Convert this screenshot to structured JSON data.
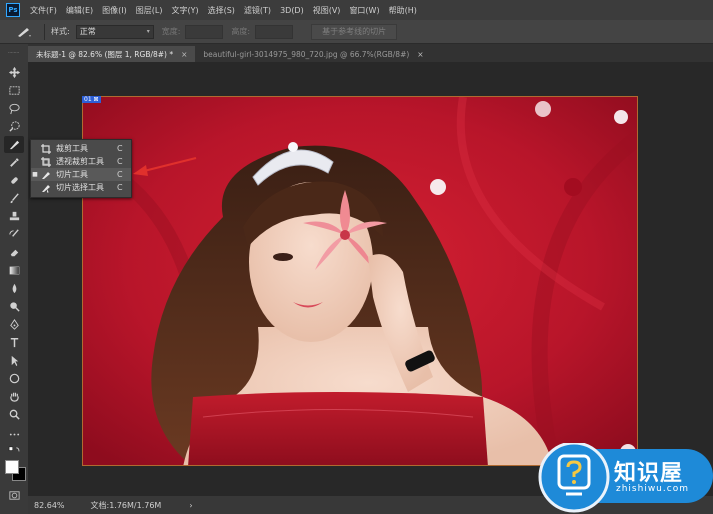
{
  "app": {
    "logo_text": "Ps"
  },
  "menu": [
    "文件(F)",
    "编辑(E)",
    "图像(I)",
    "图层(L)",
    "文字(Y)",
    "选择(S)",
    "滤镜(T)",
    "3D(D)",
    "视图(V)",
    "窗口(W)",
    "帮助(H)"
  ],
  "options": {
    "style_label": "样式:",
    "style_value": "正常",
    "width_label": "宽度:",
    "height_label": "高度:",
    "guides_button": "基于参考线的切片"
  },
  "tabs": [
    {
      "label": "未标题-1 @ 82.6% (图层 1, RGB/8#) *",
      "close": "×"
    },
    {
      "label": "beautiful-girl-3014975_980_720.jpg @ 66.7%(RGB/8#)",
      "close": "×"
    }
  ],
  "flyout": [
    {
      "label": "裁剪工具",
      "shortcut": "C",
      "selected": false,
      "icon": "crop-icon"
    },
    {
      "label": "透视裁剪工具",
      "shortcut": "C",
      "selected": false,
      "icon": "perspective-crop-icon"
    },
    {
      "label": "切片工具",
      "shortcut": "C",
      "selected": true,
      "icon": "slice-icon"
    },
    {
      "label": "切片选择工具",
      "shortcut": "C",
      "selected": false,
      "icon": "slice-select-icon"
    }
  ],
  "slice_badge": "01 ⊠",
  "status": {
    "zoom": "82.64%",
    "doc": "文档:1.76M/1.76M",
    "arrow": "›"
  },
  "watermark": {
    "brand": "知识屋",
    "url": "zhishiwu.com"
  },
  "colors": {
    "accent": "#31a8ff",
    "annotation_arrow": "#e0302c",
    "slice_badge": "#2d5fd6",
    "backdrop": "#c41a2b",
    "watermark_blue": "#1e8ad8"
  }
}
